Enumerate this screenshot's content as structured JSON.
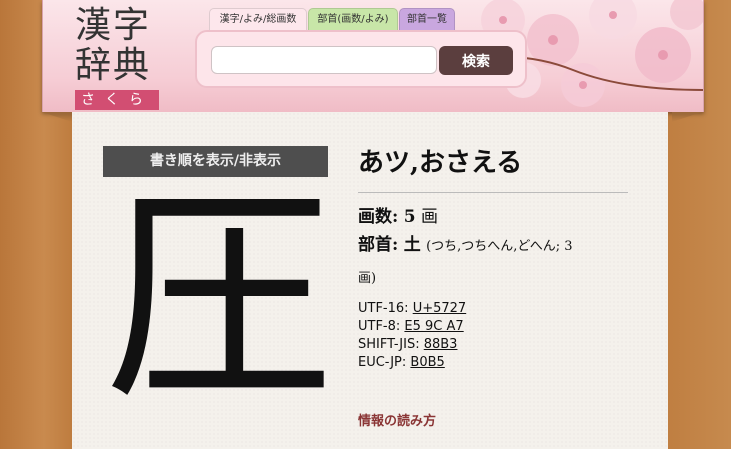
{
  "logo": {
    "line1": "漢字",
    "line2": "辞典",
    "sub": "さくら"
  },
  "tabs": [
    {
      "label": "漢字/よみ/総画数"
    },
    {
      "label": "部首(画数/よみ)"
    },
    {
      "label": "部首一覧"
    }
  ],
  "search": {
    "value": "",
    "placeholder": "",
    "button_label": "検索"
  },
  "stroke_order_button": "書き順を表示/非表示",
  "kanji": "圧",
  "reading": "あツ,おさえる",
  "stroke_count": {
    "label": "画数:",
    "value": "5",
    "unit": "画"
  },
  "radical": {
    "label": "部首:",
    "char": "土",
    "detail": "(つち,つちへん,どへん; 3",
    "detail2": "画)"
  },
  "codes": [
    {
      "label": "UTF-16:",
      "value": "U+5727"
    },
    {
      "label": "UTF-8:",
      "value": "E5 9C A7"
    },
    {
      "label": "SHIFT-JIS:",
      "value": "88B3"
    },
    {
      "label": "EUC-JP:",
      "value": "B0B5"
    }
  ],
  "info_link": "情報の読み方",
  "colors": {
    "accent_pink": "#d24e72",
    "button_dark": "#5b3e3e",
    "link_red": "#8a3535"
  }
}
